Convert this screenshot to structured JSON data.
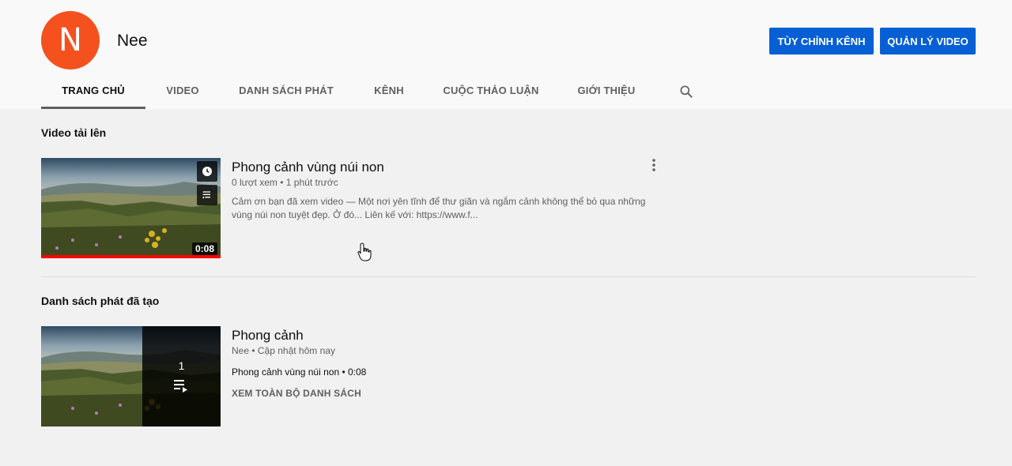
{
  "channel": {
    "avatar_letter": "N",
    "avatar_color": "#f4511e",
    "name": "Nee",
    "customize_label": "TÙY CHỈNH KÊNH",
    "manage_label": "QUẢN LÝ VIDEO",
    "button_color": "#065fd4"
  },
  "tabs": [
    {
      "label": "TRANG CHỦ",
      "active": true
    },
    {
      "label": "VIDEO",
      "active": false
    },
    {
      "label": "DANH SÁCH PHÁT",
      "active": false
    },
    {
      "label": "KÊNH",
      "active": false
    },
    {
      "label": "CUỘC THẢO LUẬN",
      "active": false
    },
    {
      "label": "GIỚI THIỆU",
      "active": false
    }
  ],
  "search_icon": "search-icon",
  "uploads": {
    "section_title": "Video tải lên",
    "video": {
      "title": "Phong cảnh vùng núi non",
      "meta": "0 lượt xem • 1 phút trước",
      "description": "Cảm ơn bạn đã xem video — Một nơi yên tĩnh để thư giãn và ngắm cảnh không thể bỏ qua những vùng núi non tuyệt đẹp. Ở đó... Liên kế với: https://www.f...",
      "duration": "0:08",
      "watch_later_icon": "clock-icon",
      "add_queue_icon": "queue-icon",
      "more_icon": "more-vert-icon",
      "progress": 1.0
    }
  },
  "playlists": {
    "section_title": "Danh sách phát đã tạo",
    "playlist": {
      "title": "Phong cảnh",
      "meta": "Nee • Cập nhật hôm nay",
      "video_count": "1",
      "first_video": "Phong cảnh vùng núi non • 0:08",
      "view_all": "XEM TOÀN BỘ DANH SÁCH",
      "playlist_icon": "playlist-play-icon"
    }
  }
}
